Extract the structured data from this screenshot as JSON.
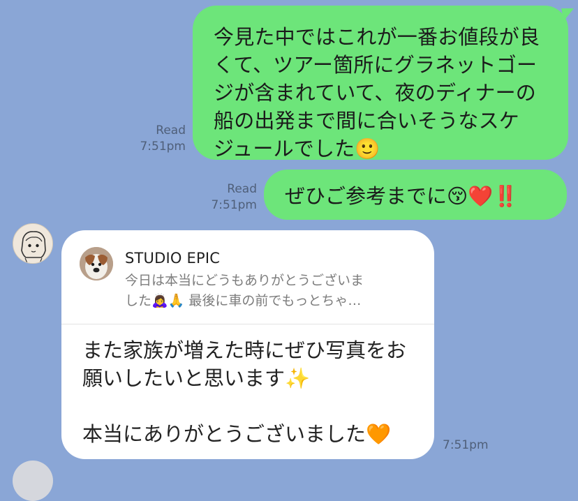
{
  "messages": {
    "out1": {
      "status": "Read",
      "time": "7:51pm",
      "text": "今見た中ではこれが一番お値段が良\nくて、ツアー箇所にグラネットゴー\nジが含まれていて、夜のディナーの\n船の出発まで間に合いそうなスケ\nジュールでした🙂"
    },
    "out2": {
      "status": "Read",
      "time": "7:51pm",
      "text": "ぜひご参考までに😚❤️‼️"
    },
    "in1": {
      "quoted_name": "STUDIO EPIC",
      "quoted_preview": "今日は本当にどうもありがとうございま\nした🙇‍♀️🙏 最後に車の前でもっとちゃ…",
      "text": "また家族が増えた時にぜひ写真をお\n願いしたいと思います✨\n\n本当にありがとうございました🧡",
      "time": "7:51pm"
    }
  },
  "avatars": {
    "sender_icon": "avatar-icon",
    "quoted_icon": "dog-photo-icon"
  },
  "colors": {
    "background": "#8aa6d6",
    "outgoing_bubble": "#6de57a",
    "incoming_bubble": "#ffffff"
  }
}
